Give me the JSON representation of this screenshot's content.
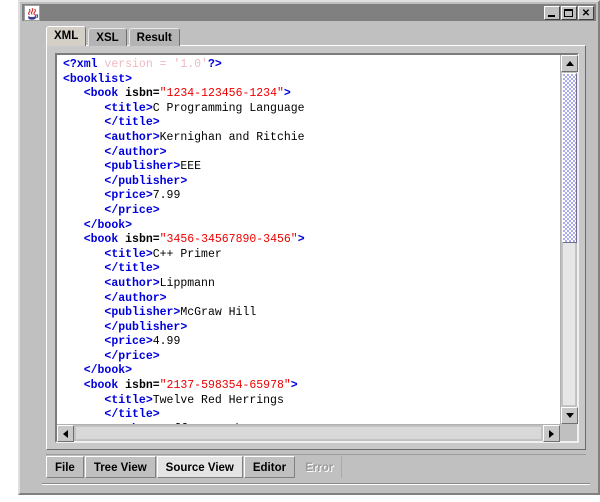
{
  "window": {
    "title": "",
    "icon": "java-duke-icon",
    "controls": [
      {
        "name": "minimize-button",
        "glyph": "minimize"
      },
      {
        "name": "maximize-button",
        "glyph": "maximize"
      },
      {
        "name": "close-button",
        "glyph": "close"
      }
    ]
  },
  "top_tabs": [
    {
      "label": "XML",
      "selected": true
    },
    {
      "label": "XSL",
      "selected": false
    },
    {
      "label": "Result",
      "selected": false
    }
  ],
  "bottom_tabs": [
    {
      "label": "File",
      "state": "normal"
    },
    {
      "label": "Tree View",
      "state": "normal"
    },
    {
      "label": "Source View",
      "state": "active"
    },
    {
      "label": "Editor",
      "state": "normal"
    },
    {
      "label": "Error",
      "state": "disabled"
    }
  ],
  "colors": {
    "tag": "#0000dd",
    "attribute_value": "#ee0000",
    "declaration": "#f0b8c0",
    "text": "#000000",
    "window_face": "#c0c0c0",
    "title_bar": "#808080",
    "scroll_thumb": "#a8a8f0"
  },
  "editor": {
    "name": "xml-source-editor",
    "lines": [
      [
        {
          "t": "tg",
          "s": "<?xml"
        },
        {
          "t": "decl",
          "s": " version = '1.0'"
        },
        {
          "t": "tg",
          "s": "?>"
        }
      ],
      [
        {
          "t": "tg",
          "s": "<booklist>"
        }
      ],
      [
        {
          "t": "txt",
          "s": "   "
        },
        {
          "t": "tg",
          "s": "<book "
        },
        {
          "t": "attr",
          "s": "isbn="
        },
        {
          "t": "val",
          "s": "\"1234-123456-1234\""
        },
        {
          "t": "tg",
          "s": ">"
        }
      ],
      [
        {
          "t": "txt",
          "s": "      "
        },
        {
          "t": "tg",
          "s": "<title>"
        },
        {
          "t": "txt",
          "s": "C Programming Language"
        }
      ],
      [
        {
          "t": "txt",
          "s": "      "
        },
        {
          "t": "tg",
          "s": "</title>"
        }
      ],
      [
        {
          "t": "txt",
          "s": "      "
        },
        {
          "t": "tg",
          "s": "<author>"
        },
        {
          "t": "txt",
          "s": "Kernighan and Ritchie"
        }
      ],
      [
        {
          "t": "txt",
          "s": "      "
        },
        {
          "t": "tg",
          "s": "</author>"
        }
      ],
      [
        {
          "t": "txt",
          "s": "      "
        },
        {
          "t": "tg",
          "s": "<publisher>"
        },
        {
          "t": "txt",
          "s": "EEE"
        }
      ],
      [
        {
          "t": "txt",
          "s": "      "
        },
        {
          "t": "tg",
          "s": "</publisher>"
        }
      ],
      [
        {
          "t": "txt",
          "s": "      "
        },
        {
          "t": "tg",
          "s": "<price>"
        },
        {
          "t": "txt",
          "s": "7.99"
        }
      ],
      [
        {
          "t": "txt",
          "s": "      "
        },
        {
          "t": "tg",
          "s": "</price>"
        }
      ],
      [
        {
          "t": "txt",
          "s": "   "
        },
        {
          "t": "tg",
          "s": "</book>"
        }
      ],
      [
        {
          "t": "txt",
          "s": "   "
        },
        {
          "t": "tg",
          "s": "<book "
        },
        {
          "t": "attr",
          "s": "isbn="
        },
        {
          "t": "val",
          "s": "\"3456-34567890-3456\""
        },
        {
          "t": "tg",
          "s": ">"
        }
      ],
      [
        {
          "t": "txt",
          "s": "      "
        },
        {
          "t": "tg",
          "s": "<title>"
        },
        {
          "t": "txt",
          "s": "C++ Primer"
        }
      ],
      [
        {
          "t": "txt",
          "s": "      "
        },
        {
          "t": "tg",
          "s": "</title>"
        }
      ],
      [
        {
          "t": "txt",
          "s": "      "
        },
        {
          "t": "tg",
          "s": "<author>"
        },
        {
          "t": "txt",
          "s": "Lippmann"
        }
      ],
      [
        {
          "t": "txt",
          "s": "      "
        },
        {
          "t": "tg",
          "s": "</author>"
        }
      ],
      [
        {
          "t": "txt",
          "s": "      "
        },
        {
          "t": "tg",
          "s": "<publisher>"
        },
        {
          "t": "txt",
          "s": "McGraw Hill"
        }
      ],
      [
        {
          "t": "txt",
          "s": "      "
        },
        {
          "t": "tg",
          "s": "</publisher>"
        }
      ],
      [
        {
          "t": "txt",
          "s": "      "
        },
        {
          "t": "tg",
          "s": "<price>"
        },
        {
          "t": "txt",
          "s": "4.99"
        }
      ],
      [
        {
          "t": "txt",
          "s": "      "
        },
        {
          "t": "tg",
          "s": "</price>"
        }
      ],
      [
        {
          "t": "txt",
          "s": "   "
        },
        {
          "t": "tg",
          "s": "</book>"
        }
      ],
      [
        {
          "t": "txt",
          "s": "   "
        },
        {
          "t": "tg",
          "s": "<book "
        },
        {
          "t": "attr",
          "s": "isbn="
        },
        {
          "t": "val",
          "s": "\"2137-598354-65978\""
        },
        {
          "t": "tg",
          "s": ">"
        }
      ],
      [
        {
          "t": "txt",
          "s": "      "
        },
        {
          "t": "tg",
          "s": "<title>"
        },
        {
          "t": "txt",
          "s": "Twelve Red Herrings"
        }
      ],
      [
        {
          "t": "txt",
          "s": "      "
        },
        {
          "t": "tg",
          "s": "</title>"
        }
      ],
      [
        {
          "t": "txt",
          "s": "      "
        },
        {
          "t": "tg",
          "s": "<author>"
        },
        {
          "t": "txt",
          "s": "Jeffrey Archer"
        }
      ]
    ]
  },
  "scrollbars": {
    "vertical": {
      "name": "vertical-scrollbar",
      "up": "scroll-up-arrow",
      "down": "scroll-down-arrow"
    },
    "horizontal": {
      "name": "horizontal-scrollbar",
      "left": "scroll-left-arrow",
      "right": "scroll-right-arrow"
    }
  }
}
